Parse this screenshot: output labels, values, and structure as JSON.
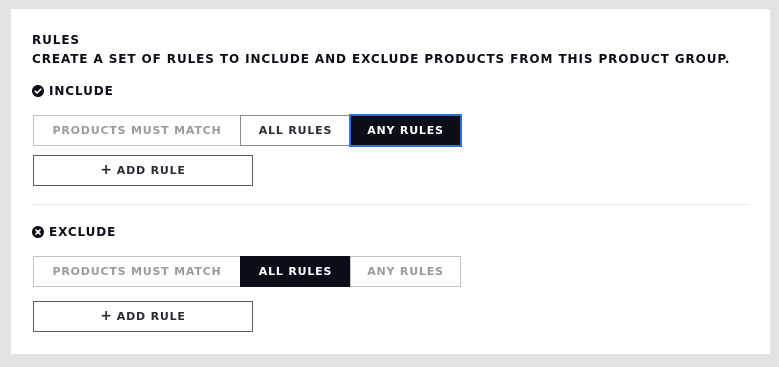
{
  "rules": {
    "title": "RULES",
    "subtitle": "CREATE A SET OF RULES TO INCLUDE AND EXCLUDE PRODUCTS FROM THIS PRODUCT GROUP."
  },
  "include": {
    "icon": "check-circle-icon",
    "title": "INCLUDE",
    "match_label": "PRODUCTS MUST MATCH",
    "all_label": "ALL RULES",
    "any_label": "ANY RULES",
    "selected": "ANY RULES",
    "add_icon": "plus-icon",
    "add_label": "ADD RULE"
  },
  "exclude": {
    "icon": "x-circle-icon",
    "title": "EXCLUDE",
    "match_label": "PRODUCTS MUST MATCH",
    "all_label": "ALL RULES",
    "any_label": "ANY RULES",
    "selected": "ALL RULES",
    "add_icon": "plus-icon",
    "add_label": "ADD RULE"
  },
  "colors": {
    "page_background": "#e3e3e3",
    "panel_background": "#ffffff",
    "active_background": "#0b0d17",
    "focus_outline": "#2d6fdc",
    "muted_text": "#9a9aa0"
  }
}
